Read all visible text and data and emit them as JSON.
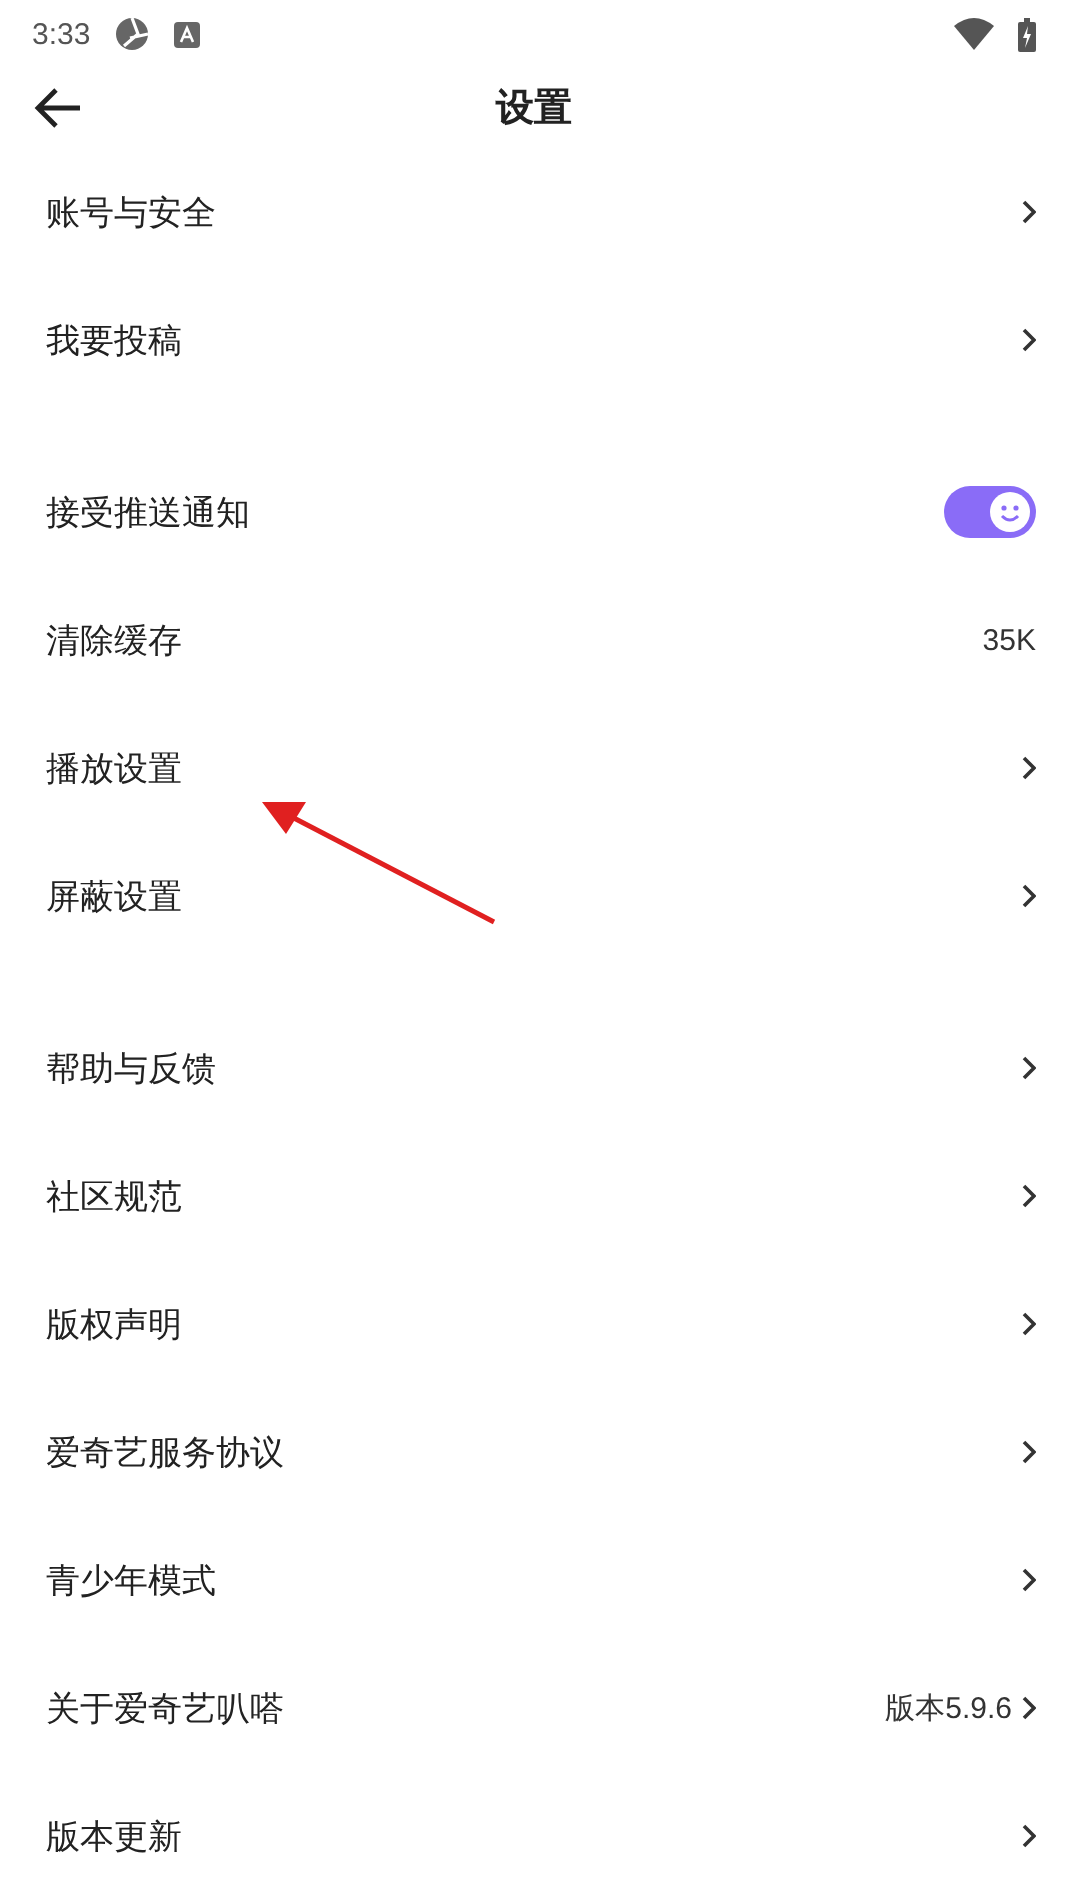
{
  "status_bar": {
    "time": "3:33"
  },
  "header": {
    "title": "设置"
  },
  "groups": [
    {
      "items": [
        {
          "kind": "link",
          "label": "账号与安全"
        },
        {
          "kind": "link",
          "label": "我要投稿"
        }
      ]
    },
    {
      "items": [
        {
          "kind": "toggle",
          "label": "接受推送通知",
          "on": true
        },
        {
          "kind": "value",
          "label": "清除缓存",
          "value": "35K"
        },
        {
          "kind": "link",
          "label": "播放设置"
        },
        {
          "kind": "link",
          "label": "屏蔽设置"
        }
      ]
    },
    {
      "items": [
        {
          "kind": "link",
          "label": "帮助与反馈"
        },
        {
          "kind": "link",
          "label": "社区规范"
        },
        {
          "kind": "link",
          "label": "版权声明"
        },
        {
          "kind": "link",
          "label": "爱奇艺服务协议"
        },
        {
          "kind": "link",
          "label": "青少年模式"
        },
        {
          "kind": "value_link",
          "label": "关于爱奇艺叭嗒",
          "value": "版本5.9.6"
        },
        {
          "kind": "link",
          "label": "版本更新"
        }
      ]
    }
  ]
}
